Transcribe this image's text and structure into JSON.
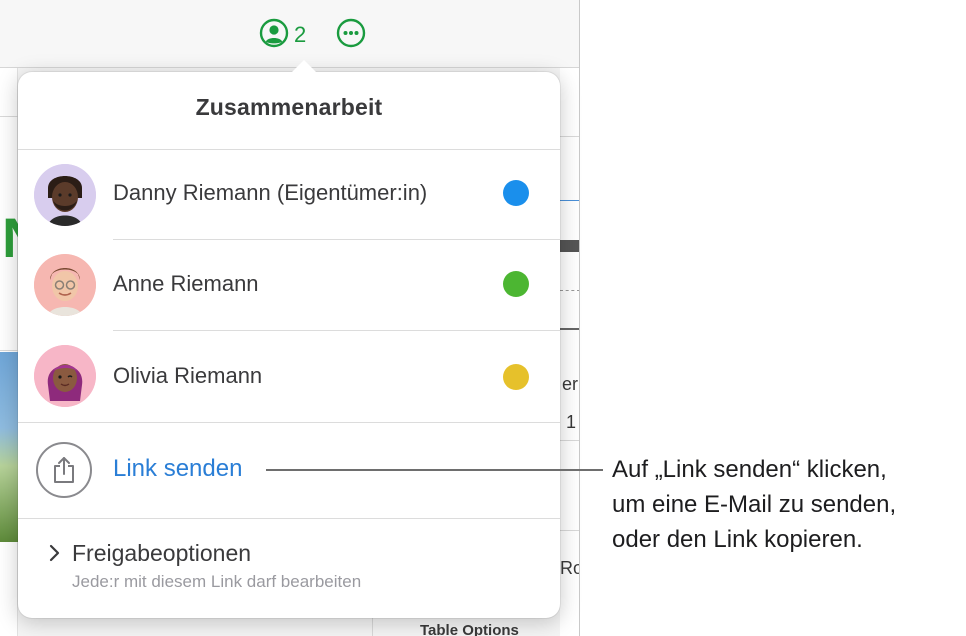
{
  "toolbar": {
    "collaborator_count": "2"
  },
  "background": {
    "green_letter": "N",
    "right_text_1": "er",
    "right_text_2": "1",
    "right_text_3": "Ro",
    "bottom_text": "Table Options"
  },
  "popover": {
    "title": "Zusammenarbeit",
    "participants": [
      {
        "name": "Danny Riemann (Eigentümer:in)",
        "color": "#1a8fec"
      },
      {
        "name": "Anne Riemann",
        "color": "#4cb632"
      },
      {
        "name": "Olivia Riemann",
        "color": "#e6c12b"
      }
    ],
    "send_link_label": "Link senden",
    "share_options": {
      "label": "Freigabeoptionen",
      "subtitle": "Jede:r mit diesem Link darf bearbeiten"
    }
  },
  "callout": {
    "lines": [
      "Auf „Link senden“ klicken,",
      "um eine E-Mail zu senden,",
      "oder den Link kopieren."
    ]
  },
  "colors": {
    "accent_green": "#1a9b3f",
    "link_blue": "#2a7ed6"
  },
  "icons": {
    "collaborate": "person-circle-icon",
    "more": "ellipsis-circle-icon",
    "share": "share-icon",
    "chevron": "chevron-right-icon"
  }
}
